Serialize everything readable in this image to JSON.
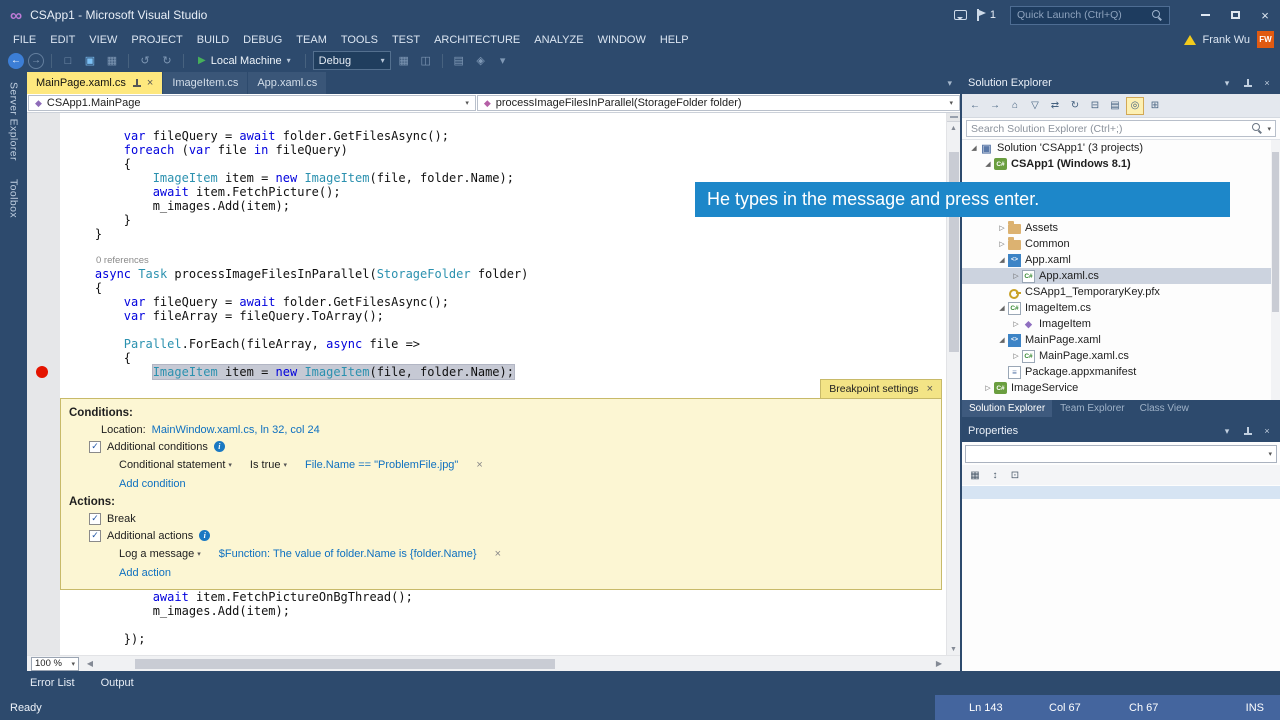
{
  "overlay": {
    "text": "He types in the message and press enter."
  },
  "title_bar": {
    "app_title": "CSApp1 - Microsoft Visual Studio",
    "feedback_count": "1",
    "quick_launch_placeholder": "Quick Launch (Ctrl+Q)"
  },
  "menu": {
    "items": [
      "FILE",
      "EDIT",
      "VIEW",
      "PROJECT",
      "BUILD",
      "DEBUG",
      "TEAM",
      "TOOLS",
      "TEST",
      "ARCHITECTURE",
      "ANALYZE",
      "WINDOW",
      "HELP"
    ],
    "user_name": "Frank Wu",
    "avatar_initials": "FW"
  },
  "toolbar": {
    "run_target": "Local Machine",
    "configuration": "Debug",
    "items": [
      {
        "name": "navigate-backward",
        "glyph": "←",
        "kind": "circle"
      },
      {
        "name": "navigate-forward",
        "glyph": "→",
        "kind": "circle-dim"
      },
      {
        "name": "sep"
      },
      {
        "name": "open-file",
        "glyph": "□",
        "kind": "dim"
      },
      {
        "name": "save",
        "glyph": "▣",
        "kind": "bright"
      },
      {
        "name": "save-all",
        "glyph": "▦",
        "kind": "dim"
      },
      {
        "name": "sep"
      },
      {
        "name": "undo",
        "glyph": "↺",
        "kind": "dim"
      },
      {
        "name": "redo",
        "glyph": "↻",
        "kind": "dim"
      },
      {
        "name": "sep"
      },
      {
        "name": "run"
      },
      {
        "name": "sep"
      },
      {
        "name": "config-combo"
      },
      {
        "name": "solution-platforms",
        "glyph": "▦",
        "kind": "dim"
      },
      {
        "name": "find-in-files",
        "glyph": "◫",
        "kind": "dim"
      },
      {
        "name": "sep"
      },
      {
        "name": "preview-changes",
        "glyph": "▤",
        "kind": "dim"
      },
      {
        "name": "toggle-bookmark",
        "glyph": "◈",
        "kind": "dim"
      },
      {
        "name": "toolbar-overflow",
        "glyph": "▾",
        "kind": "dim"
      }
    ]
  },
  "side_tabs": [
    "Server Explorer",
    "Toolbox"
  ],
  "editor": {
    "tabs": [
      {
        "label": "MainPage.xaml.cs",
        "active": true
      },
      {
        "label": "ImageItem.cs",
        "active": false
      },
      {
        "label": "App.xaml.cs",
        "active": false
      }
    ],
    "nav_type": "CSApp1.MainPage",
    "nav_member": "processImageFilesInParallel(StorageFolder folder)",
    "zoom": "100 %"
  },
  "code": {
    "top": [
      {
        "seg": []
      },
      {
        "seg": [
          [
            "        ",
            ""
          ],
          [
            "var",
            "k"
          ],
          [
            " fileQuery = ",
            ""
          ],
          [
            "await",
            "k"
          ],
          [
            " folder.GetFilesAsync();",
            ""
          ]
        ]
      },
      {
        "seg": [
          [
            "        ",
            ""
          ],
          [
            "foreach",
            "k"
          ],
          [
            " (",
            ""
          ],
          [
            "var",
            "k"
          ],
          [
            " file ",
            ""
          ],
          [
            "in",
            "k"
          ],
          [
            " fileQuery)",
            ""
          ]
        ]
      },
      {
        "seg": [
          [
            "        {",
            ""
          ]
        ]
      },
      {
        "seg": [
          [
            "            ",
            ""
          ],
          [
            "ImageItem",
            "t"
          ],
          [
            " item = ",
            ""
          ],
          [
            "new",
            "k"
          ],
          [
            " ",
            ""
          ],
          [
            "ImageItem",
            "t"
          ],
          [
            "(file, folder.Name);",
            ""
          ]
        ]
      },
      {
        "seg": [
          [
            "            ",
            ""
          ],
          [
            "await",
            "k"
          ],
          [
            " item.FetchPicture();",
            ""
          ]
        ]
      },
      {
        "seg": [
          [
            "            m_images.Add(item);",
            ""
          ]
        ]
      },
      {
        "seg": [
          [
            "        }",
            ""
          ]
        ]
      },
      {
        "seg": [
          [
            "    }",
            ""
          ]
        ]
      },
      {
        "seg": []
      },
      {
        "lens": "0 references"
      },
      {
        "seg": [
          [
            "    ",
            ""
          ],
          [
            "async",
            "k"
          ],
          [
            " ",
            ""
          ],
          [
            "Task",
            "t"
          ],
          [
            " processImageFilesInParallel(",
            ""
          ],
          [
            "StorageFolder",
            "t"
          ],
          [
            " folder)",
            ""
          ]
        ]
      },
      {
        "seg": [
          [
            "    {",
            ""
          ]
        ]
      },
      {
        "seg": [
          [
            "        ",
            ""
          ],
          [
            "var",
            "k"
          ],
          [
            " fileQuery = ",
            ""
          ],
          [
            "await",
            "k"
          ],
          [
            " folder.GetFilesAsync();",
            ""
          ]
        ]
      },
      {
        "seg": [
          [
            "        ",
            ""
          ],
          [
            "var",
            "k"
          ],
          [
            " fileArray = fileQuery.ToArray();",
            ""
          ]
        ]
      },
      {
        "seg": []
      },
      {
        "seg": [
          [
            "        ",
            ""
          ],
          [
            "Parallel",
            "t"
          ],
          [
            ".ForEach(fileArray, ",
            ""
          ],
          [
            "async",
            "k"
          ],
          [
            " file =>",
            ""
          ]
        ]
      },
      {
        "seg": [
          [
            "        {",
            ""
          ]
        ]
      }
    ],
    "highlight": {
      "indent": "            ",
      "seg": [
        [
          "ImageItem",
          "t"
        ],
        [
          " item = ",
          ""
        ],
        [
          "new",
          "k"
        ],
        [
          " ",
          ""
        ],
        [
          "ImageItem",
          "t"
        ],
        [
          "(file, folder.Name);",
          ""
        ]
      ]
    },
    "bottom": [
      {
        "seg": [
          [
            "            ",
            ""
          ],
          [
            "await",
            "k"
          ],
          [
            " item.FetchPictureOnBgThread();",
            ""
          ]
        ]
      },
      {
        "seg": [
          [
            "            m_images.Add(item);",
            ""
          ]
        ]
      },
      {
        "seg": []
      },
      {
        "seg": [
          [
            "        });",
            ""
          ]
        ]
      }
    ]
  },
  "peek": {
    "tab_label": "Breakpoint settings",
    "conditions_header": "Conditions:",
    "location_label": "Location:",
    "location_value": "MainWindow.xaml.cs, ln 32, col 24",
    "additional_conditions": "Additional conditions",
    "conditional_statement": "Conditional statement",
    "is_true": "Is true",
    "condition_expr": "File.Name == \"ProblemFile.jpg\"",
    "add_condition": "Add condition",
    "actions_header": "Actions:",
    "break_label": "Break",
    "additional_actions": "Additional actions",
    "log_a_message": "Log a message",
    "log_expr": "$Function: The value of folder.Name is {folder.Name}",
    "add_action": "Add action"
  },
  "solution_explorer": {
    "title": "Solution Explorer",
    "search_placeholder": "Search Solution Explorer (Ctrl+;)",
    "toolbar": [
      {
        "name": "navigate-backward",
        "glyph": "←"
      },
      {
        "name": "navigate-forward",
        "glyph": "→"
      },
      {
        "name": "home",
        "glyph": "⌂"
      },
      {
        "name": "filter",
        "glyph": "▽"
      },
      {
        "name": "sync-with-active-document",
        "glyph": "⇄"
      },
      {
        "name": "refresh",
        "glyph": "↻"
      },
      {
        "name": "collapse-all",
        "glyph": "⊟"
      },
      {
        "name": "show-all-files",
        "glyph": "▤"
      },
      {
        "name": "preview-selected-items",
        "glyph": "◎",
        "active": true
      },
      {
        "name": "properties-page",
        "glyph": "⊞"
      }
    ],
    "tree": [
      {
        "indent": 0,
        "expander": "expanded",
        "icon": "solution",
        "label": "Solution 'CSApp1' (3 projects)"
      },
      {
        "indent": 1,
        "expander": "expanded",
        "icon": "project",
        "label": "CSApp1 (Windows 8.1)",
        "bold": true
      },
      {
        "indent": 2,
        "expander": "",
        "icon": "",
        "label": ""
      },
      {
        "indent": 2,
        "expander": "",
        "icon": "",
        "label": ""
      },
      {
        "indent": 2,
        "expander": "",
        "icon": "",
        "label": ""
      },
      {
        "indent": 2,
        "expander": "collapsed",
        "icon": "folder",
        "label": "Assets"
      },
      {
        "indent": 2,
        "expander": "collapsed",
        "icon": "folder",
        "label": "Common"
      },
      {
        "indent": 2,
        "expander": "expanded",
        "icon": "xaml",
        "label": "App.xaml"
      },
      {
        "indent": 3,
        "expander": "collapsed",
        "icon": "cs",
        "label": "App.xaml.cs",
        "selected": true
      },
      {
        "indent": 2,
        "expander": "",
        "icon": "key",
        "label": "CSApp1_TemporaryKey.pfx"
      },
      {
        "indent": 2,
        "expander": "expanded",
        "icon": "cs",
        "label": "ImageItem.cs"
      },
      {
        "indent": 3,
        "expander": "collapsed",
        "icon": "class",
        "label": "ImageItem"
      },
      {
        "indent": 2,
        "expander": "expanded",
        "icon": "xaml",
        "label": "MainPage.xaml"
      },
      {
        "indent": 3,
        "expander": "collapsed",
        "icon": "cs",
        "label": "MainPage.xaml.cs"
      },
      {
        "indent": 2,
        "expander": "",
        "icon": "manifest",
        "label": "Package.appxmanifest"
      },
      {
        "indent": 1,
        "expander": "collapsed",
        "icon": "project2",
        "label": "ImageService"
      }
    ],
    "tabs": [
      {
        "label": "Solution Explorer",
        "active": true
      },
      {
        "label": "Team Explorer",
        "active": false
      },
      {
        "label": "Class View",
        "active": false
      }
    ]
  },
  "properties": {
    "title": "Properties",
    "toolbar": [
      {
        "name": "categorized",
        "glyph": "▦"
      },
      {
        "name": "alphabetical",
        "glyph": "↕"
      },
      {
        "name": "property-pages",
        "glyph": "⊡"
      }
    ]
  },
  "bottom_tabs": [
    {
      "label": "Error List"
    },
    {
      "label": "Output"
    }
  ],
  "status": {
    "ready": "Ready",
    "ln": "Ln 143",
    "col": "Col 67",
    "ch": "Ch 67",
    "ins": "INS"
  }
}
